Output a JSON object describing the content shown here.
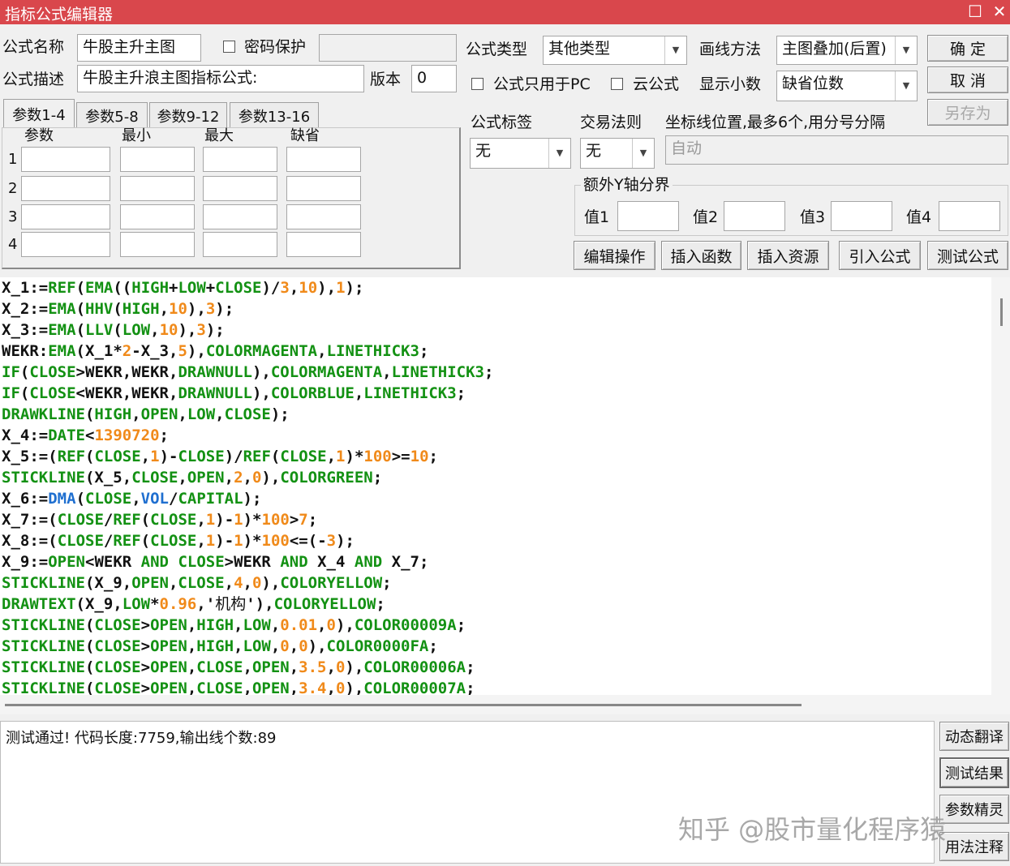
{
  "window": {
    "title": "指标公式编辑器",
    "maximize_icon": "☐",
    "close_icon": "✕"
  },
  "form": {
    "name_label": "公式名称",
    "name_value": "牛股主升主图",
    "password_label": "密码保护",
    "password_value": "",
    "desc_label": "公式描述",
    "desc_value": "牛股主升浪主图指标公式:",
    "version_label": "版本",
    "version_value": "0",
    "type_label": "公式类型",
    "type_value": "其他类型",
    "draw_label": "画线方法",
    "draw_value": "主图叠加(后置)",
    "pc_only_label": "公式只用于PC",
    "cloud_label": "云公式",
    "decimals_label": "显示小数",
    "decimals_value": "缺省位数",
    "tag_label": "公式标签",
    "tag_value": "无",
    "trade_label": "交易法则",
    "trade_value": "无",
    "coord_label": "坐标线位置,最多6个,用分号分隔",
    "coord_value": "自动"
  },
  "buttons": {
    "ok": "确 定",
    "cancel": "取 消",
    "save_as": "另存为"
  },
  "tabs": [
    "参数1-4",
    "参数5-8",
    "参数9-12",
    "参数13-16"
  ],
  "params": {
    "headers": [
      "参数",
      "最小",
      "最大",
      "缺省"
    ],
    "rows": [
      "1",
      "2",
      "3",
      "4"
    ]
  },
  "yaxis": {
    "title": "额外Y轴分界",
    "labels": [
      "值1",
      "值2",
      "值3",
      "值4"
    ]
  },
  "toolbar": [
    "编辑操作",
    "插入函数",
    "插入资源",
    "引入公式",
    "测试公式"
  ],
  "code": [
    "X_1:=REF(EMA((HIGH+LOW+CLOSE)/3,10),1);",
    "X_2:=EMA(HHV(HIGH,10),3);",
    "X_3:=EMA(LLV(LOW,10),3);",
    "WEKR:EMA(X_1*2-X_3,5),COLORMAGENTA,LINETHICK3;",
    "IF(CLOSE>WEKR,WEKR,DRAWNULL),COLORMAGENTA,LINETHICK3;",
    "IF(CLOSE<WEKR,WEKR,DRAWNULL),COLORBLUE,LINETHICK3;",
    "DRAWKLINE(HIGH,OPEN,LOW,CLOSE);",
    "X_4:=DATE<1390720;",
    "X_5:=(REF(CLOSE,1)-CLOSE)/REF(CLOSE,1)*100>=10;",
    "STICKLINE(X_5,CLOSE,OPEN,2,0),COLORGREEN;",
    "X_6:=DMA(CLOSE,VOL/CAPITAL);",
    "X_7:=(CLOSE/REF(CLOSE,1)-1)*100>7;",
    "X_8:=(CLOSE/REF(CLOSE,1)-1)*100<=(-3);",
    "X_9:=OPEN<WEKR AND CLOSE>WEKR AND X_4 AND X_7;",
    "STICKLINE(X_9,OPEN,CLOSE,4,0),COLORYELLOW;",
    "DRAWTEXT(X_9,LOW*0.96,'机构'),COLORYELLOW;",
    "STICKLINE(CLOSE>OPEN,HIGH,LOW,0.01,0),COLOR00009A;",
    "STICKLINE(CLOSE>OPEN,HIGH,LOW,0,0),COLOR0000FA;",
    "STICKLINE(CLOSE>OPEN,CLOSE,OPEN,3.5,0),COLOR00006A;",
    "STICKLINE(CLOSE>OPEN,CLOSE,OPEN,3.4,0),COLOR00007A;"
  ],
  "colors": {
    "titlebar": "#d9474c",
    "keyword": "#139113",
    "number": "#f08a1a",
    "builtin": "#1f6fd0"
  },
  "result": {
    "text": "测试通过! 代码长度:7759,输出线个数:89"
  },
  "side_buttons": [
    "动态翻译",
    "测试结果",
    "参数精灵",
    "用法注释"
  ],
  "watermark": "知乎 @股市量化程序猿"
}
